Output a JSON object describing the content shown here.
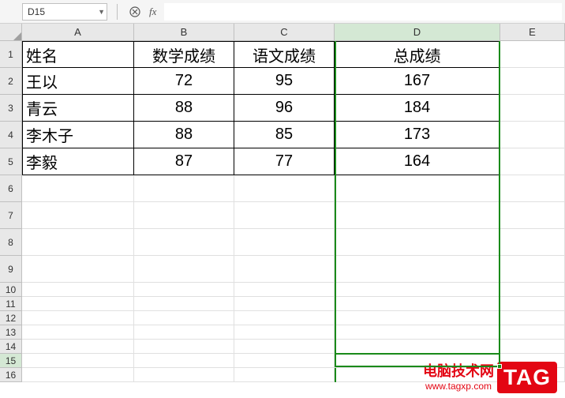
{
  "toolbar": {
    "name_box_value": "D15",
    "fx_label": "fx",
    "formula_value": ""
  },
  "columns": [
    "A",
    "B",
    "C",
    "D",
    "E"
  ],
  "row_numbers": [
    1,
    2,
    3,
    4,
    5,
    6,
    7,
    8,
    9,
    10,
    11,
    12,
    13,
    14,
    15,
    16
  ],
  "chart_data": {
    "type": "table",
    "headers": [
      "姓名",
      "数学成绩",
      "语文成绩",
      "总成绩"
    ],
    "rows": [
      {
        "name": "王以",
        "math": 72,
        "chinese": 95,
        "total": 167
      },
      {
        "name": "青云",
        "math": 88,
        "chinese": 96,
        "total": 184
      },
      {
        "name": "李木子",
        "math": 88,
        "chinese": 85,
        "total": 173
      },
      {
        "name": "李毅",
        "math": 87,
        "chinese": 77,
        "total": 164
      }
    ]
  },
  "selected_cell": "D15",
  "highlighted_column": "D",
  "watermark": {
    "cn": "电脑技术网",
    "url": "www.tagxp.com",
    "tag": "TAG"
  }
}
